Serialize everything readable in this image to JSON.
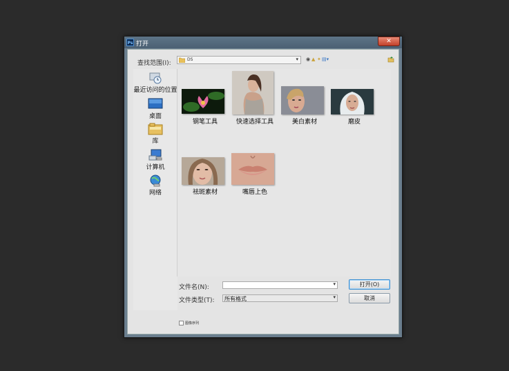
{
  "dialog": {
    "title": "打开",
    "app_icon": "Ps",
    "close_glyph": "✕"
  },
  "lookin": {
    "label": "查找范围(I):",
    "value": "DS"
  },
  "places": [
    {
      "label": "最近访问的位置",
      "icon": "recent-places-icon"
    },
    {
      "label": "桌面",
      "icon": "desktop-icon"
    },
    {
      "label": "库",
      "icon": "library-icon"
    },
    {
      "label": "计算机",
      "icon": "computer-icon"
    },
    {
      "label": "网络",
      "icon": "network-icon"
    }
  ],
  "files": [
    {
      "name": "钢笔工具"
    },
    {
      "name": "快速选择工具"
    },
    {
      "name": "美白素材"
    },
    {
      "name": "磨皮"
    },
    {
      "name": "祛斑素材"
    },
    {
      "name": "嘴唇上色"
    }
  ],
  "filename": {
    "label": "文件名(N):",
    "value": ""
  },
  "filetype": {
    "label": "文件类型(T):",
    "value": "所有格式"
  },
  "buttons": {
    "open": "打开(O)",
    "cancel": "取消"
  },
  "sequence": {
    "label": "图像序列"
  }
}
